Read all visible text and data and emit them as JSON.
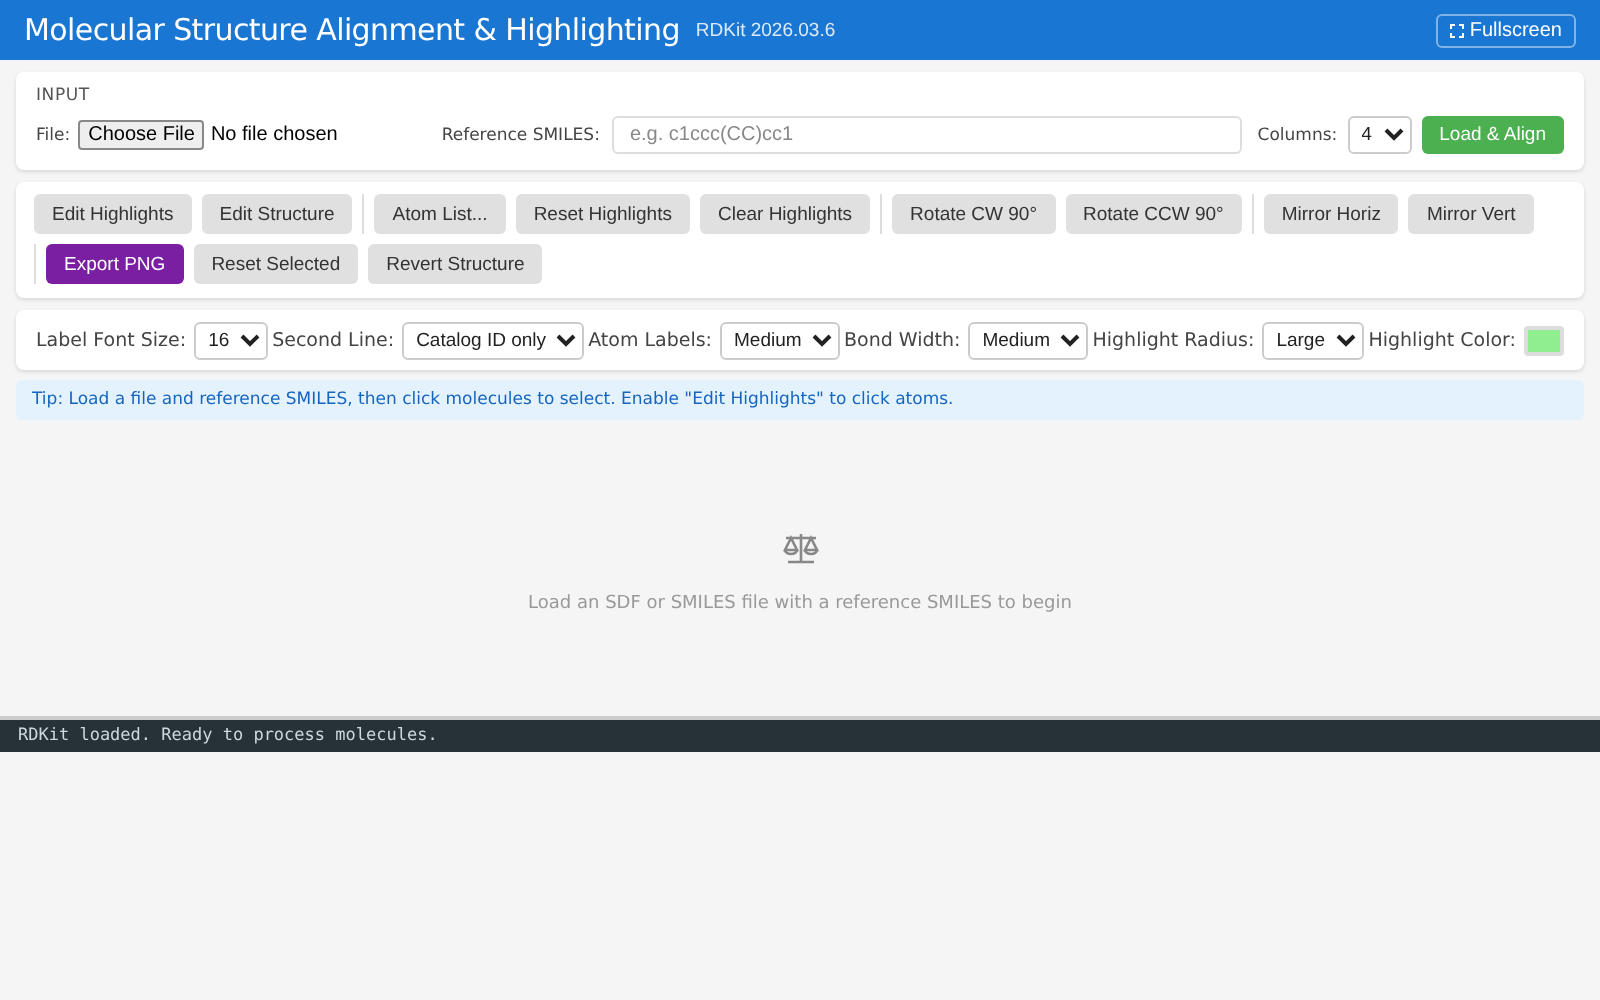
{
  "header": {
    "title": "Molecular Structure Alignment & Highlighting",
    "version": "RDKit 2026.03.6",
    "fullscreen_button": "Fullscreen"
  },
  "input": {
    "section_title": "INPUT",
    "file_label": "File:",
    "file_button": "Choose File",
    "file_status": "No file chosen",
    "smiles_label": "Reference SMILES:",
    "smiles_placeholder": "e.g. c1ccc(CC)cc1",
    "columns_label": "Columns:",
    "columns_value": "4",
    "load_button": "Load & Align"
  },
  "toolbar": {
    "groups": [
      {
        "divider": false,
        "buttons": [
          {
            "label": "Edit Highlights",
            "kind": "default"
          },
          {
            "label": "Edit Structure",
            "kind": "default"
          }
        ]
      },
      {
        "divider": true,
        "buttons": [
          {
            "label": "Atom List...",
            "kind": "default"
          },
          {
            "label": "Reset Highlights",
            "kind": "default"
          },
          {
            "label": "Clear Highlights",
            "kind": "default"
          }
        ]
      },
      {
        "divider": true,
        "buttons": [
          {
            "label": "Rotate CW 90°",
            "kind": "default"
          },
          {
            "label": "Rotate CCW 90°",
            "kind": "default"
          }
        ]
      },
      {
        "divider": true,
        "buttons": [
          {
            "label": "Mirror Horiz",
            "kind": "default"
          },
          {
            "label": "Mirror Vert",
            "kind": "default"
          }
        ]
      },
      {
        "divider": true,
        "buttons": [
          {
            "label": "Export PNG",
            "kind": "export"
          }
        ]
      },
      {
        "divider": false,
        "buttons": [
          {
            "label": "Reset Selected",
            "kind": "default"
          },
          {
            "label": "Revert Structure",
            "kind": "default"
          }
        ]
      }
    ]
  },
  "options": [
    {
      "label": "Label Font Size:",
      "kind": "select",
      "value": "16"
    },
    {
      "label": "Second Line:",
      "kind": "select",
      "value": "Catalog ID only"
    },
    {
      "label": "Atom Labels:",
      "kind": "select",
      "value": "Medium"
    },
    {
      "label": "Bond Width:",
      "kind": "select",
      "value": "Medium"
    },
    {
      "label": "Highlight Radius:",
      "kind": "select",
      "value": "Large"
    },
    {
      "label": "Highlight Color:",
      "kind": "color",
      "color": "#90ee90"
    }
  ],
  "tip": "Tip: Load a file and reference SMILES, then click molecules to select. Enable \"Edit Highlights\" to click atoms.",
  "empty_state": {
    "message": "Load an SDF or SMILES file with a reference SMILES to begin"
  },
  "status_bar": "RDKit loaded. Ready to process molecules."
}
